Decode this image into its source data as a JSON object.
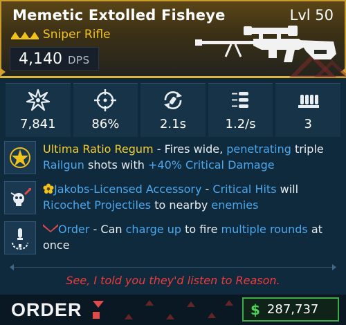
{
  "weapon": {
    "name": "Memetic Extolled Fisheye",
    "level": "Lvl 50",
    "type": "Sniper Rifle",
    "rarity_color": "#f1c21b",
    "dps_value": "4,140",
    "dps_unit": "DPS"
  },
  "stats": [
    {
      "icon": "damage-burst-icon",
      "value": "7,841"
    },
    {
      "icon": "crosshair-accuracy-icon",
      "value": "86%"
    },
    {
      "icon": "reload-icon",
      "value": "2.1s"
    },
    {
      "icon": "fire-rate-bullets-icon",
      "value": "1.2/s"
    },
    {
      "icon": "magazine-ammo-icon",
      "value": "3"
    }
  ],
  "perks": [
    {
      "icon": "gold-star-emblem-icon",
      "name": "Ultima Ratio Regum",
      "t1": " - Fires wide, ",
      "k1": "penetrating",
      "t2": " triple ",
      "k2": "Railgun",
      "t3": " shots with ",
      "k3": "+40% Critical Damage"
    },
    {
      "icon": "skull-ricochet-icon",
      "badge_icon": "jakobs-flower-icon",
      "name": "Jakobs-Licensed Accessory",
      "t1": " - ",
      "k1": "Critical Hits",
      "t2": " will ",
      "k2": "Ricochet Projectiles",
      "t3": " to nearby ",
      "k3": "enemies"
    },
    {
      "icon": "charge-round-icon",
      "badge_icon": "order-chevron-icon",
      "name": "Order",
      "t1": " - Can ",
      "k1": "charge up",
      "t2": " to fire ",
      "k2": "multiple rounds",
      "t3": " at once"
    }
  ],
  "flavor_text": "See, I told you they'd listen to Reason.",
  "manufacturer": "ORDER",
  "price": {
    "icon": "$",
    "value": "287,737"
  },
  "colors": {
    "legendary_gold": "#f1c21b",
    "keyword_blue": "#4aa8ee",
    "flavor_red": "#ee3b3b",
    "price_green": "#3fae4a"
  }
}
